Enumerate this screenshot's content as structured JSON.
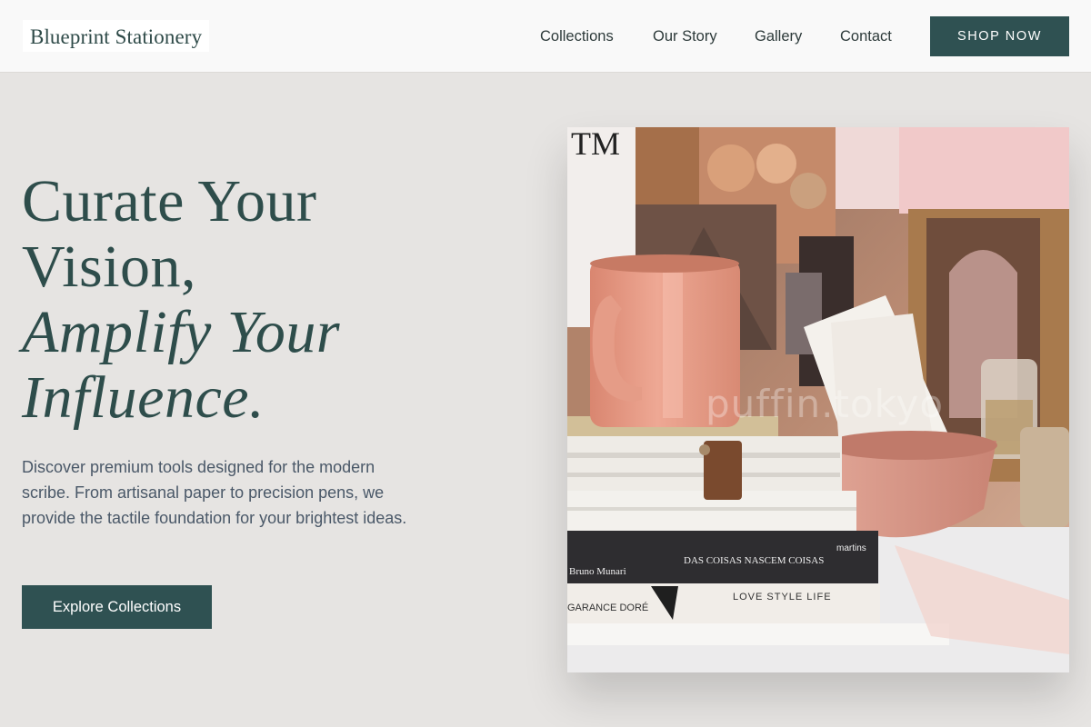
{
  "header": {
    "logo": "Blueprint Stationery",
    "nav": [
      "Collections",
      "Our Story",
      "Gallery",
      "Contact"
    ],
    "cta": "SHOP NOW"
  },
  "hero": {
    "headline_line1": "Curate Your",
    "headline_line2": "Vision,",
    "headline_line3": "Amplify Your",
    "headline_line4": "Influence.",
    "description": "Discover premium tools designed for the modern scribe. From artisanal paper to precision pens, we provide the tactile foundation for your brightest ideas.",
    "cta": "Explore Collections"
  },
  "image": {
    "watermark": "puffin.tokyo",
    "book_texts": {
      "magazine_top": "TM",
      "author": "Bruno Munari",
      "book_title": "DAS COISAS NASCEM COISAS",
      "publisher": "martins",
      "bottom_author": "GARANCE DORÉ",
      "bottom_title": "LOVE  STYLE  LIFE"
    }
  },
  "colors": {
    "primary": "#2f5152",
    "background": "#e6e4e2",
    "header_bg": "#f9f9f9",
    "body_text": "#4a5868",
    "mug": "#e39a86"
  }
}
